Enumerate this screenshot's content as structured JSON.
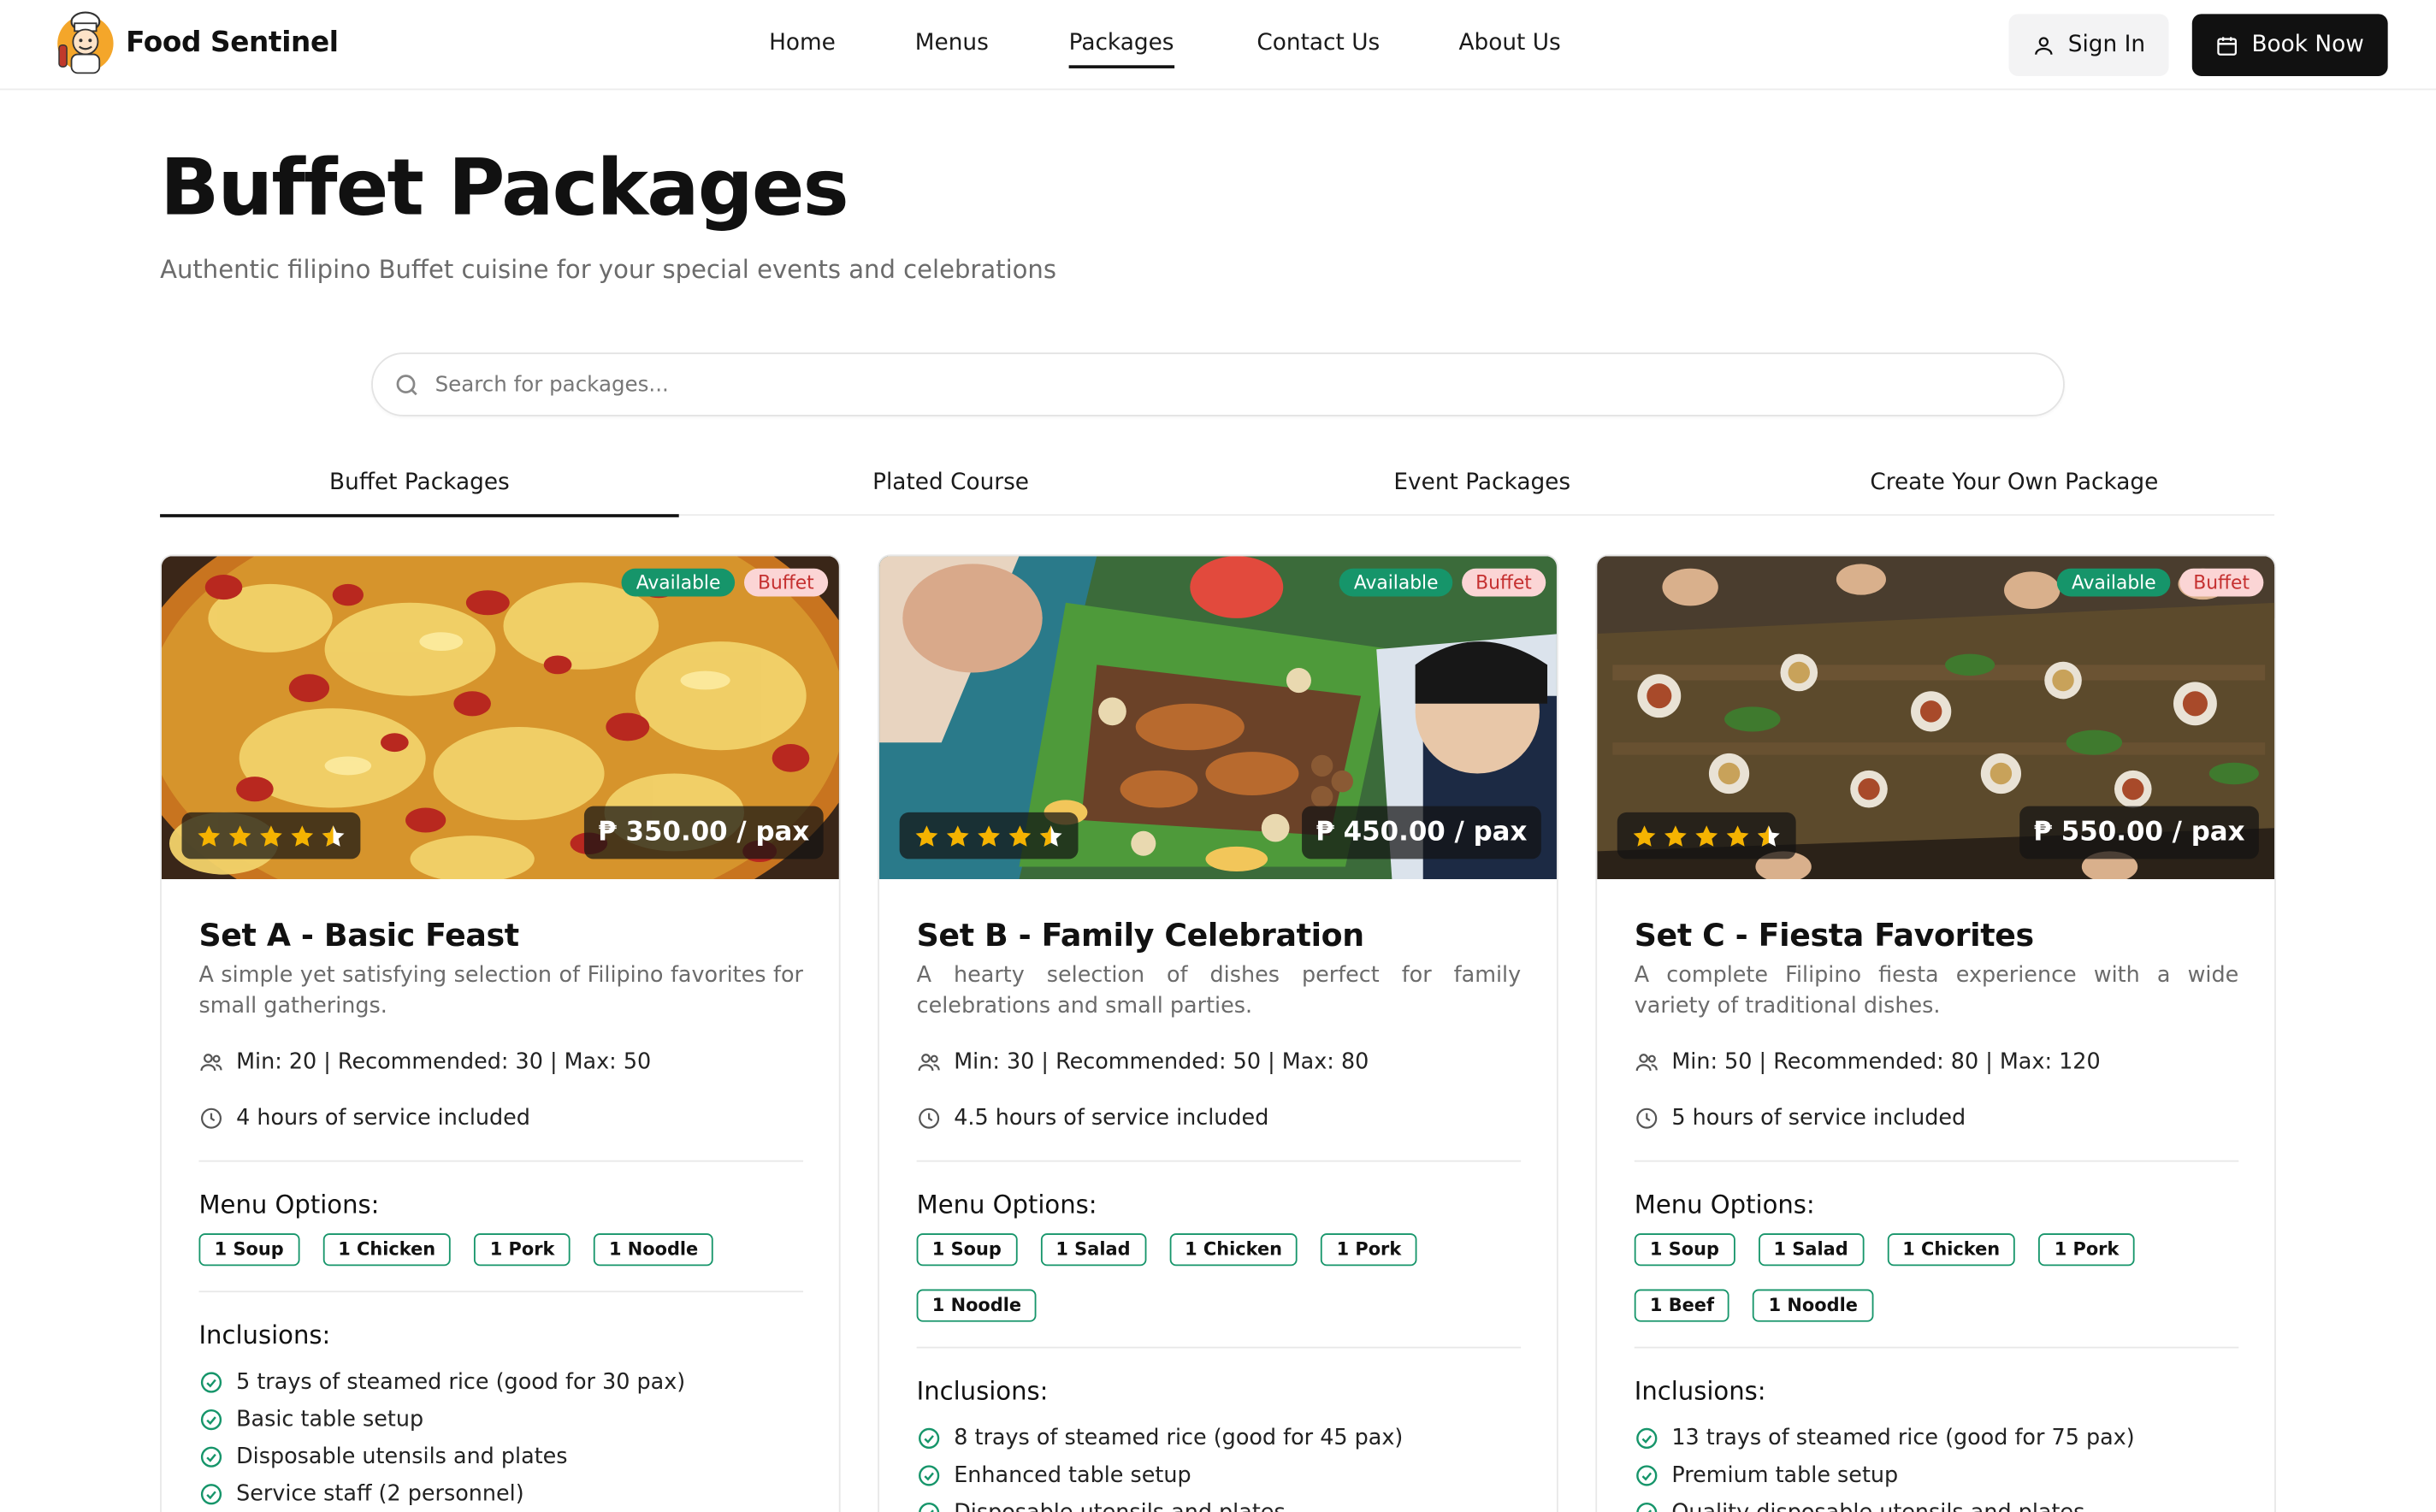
{
  "brand": {
    "name": "Food Sentinel"
  },
  "nav": {
    "links": [
      "Home",
      "Menus",
      "Packages",
      "Contact Us",
      "About Us"
    ],
    "active": "Packages",
    "sign_in": "Sign In",
    "book_now": "Book Now"
  },
  "header": {
    "title": "Buffet Packages",
    "subtitle": "Authentic filipino Buffet cuisine for your special events and celebrations"
  },
  "search": {
    "placeholder": "Search for packages..."
  },
  "tabs": {
    "items": [
      "Buffet Packages",
      "Plated Course",
      "Event Packages",
      "Create Your Own Package"
    ],
    "active": "Buffet Packages"
  },
  "colors": {
    "accent": "#16956a",
    "badge_buffet_bg": "#fbd5d5",
    "badge_buffet_text": "#c53030",
    "primary": "#111111",
    "star": "#f5b301"
  },
  "cards": [
    {
      "badge_status": "Available",
      "badge_type": "Buffet",
      "rating": 4.5,
      "price": "₱ 350.00 / pax",
      "name": "Set A - Basic Feast",
      "description": "A simple yet satisfying selection of Filipino favorites for small gatherings.",
      "capacity": "Min: 20 | Recommended: 30 | Max: 50",
      "service": "4 hours of service included",
      "menu_heading": "Menu Options:",
      "menu": [
        "1 Soup",
        "1 Chicken",
        "1 Pork",
        "1 Noodle"
      ],
      "inclusions_heading": "Inclusions:",
      "inclusions": [
        "5 trays of steamed rice (good for 30 pax)",
        "Basic table setup",
        "Disposable utensils and plates",
        "Service staff (2 personnel)"
      ]
    },
    {
      "badge_status": "Available",
      "badge_type": "Buffet",
      "rating": 4.5,
      "price": "₱ 450.00 / pax",
      "name": "Set B - Family Celebration",
      "description": "A hearty selection of dishes perfect for family celebrations and small parties.",
      "capacity": "Min: 30 | Recommended: 50 | Max: 80",
      "service": "4.5 hours of service included",
      "menu_heading": "Menu Options:",
      "menu": [
        "1 Soup",
        "1 Salad",
        "1 Chicken",
        "1 Pork",
        "1 Noodle"
      ],
      "inclusions_heading": "Inclusions:",
      "inclusions": [
        "8 trays of steamed rice (good for 45 pax)",
        "Enhanced table setup",
        "Disposable utensils and plates"
      ]
    },
    {
      "badge_status": "Available",
      "badge_type": "Buffet",
      "rating": 4.5,
      "price": "₱ 550.00 / pax",
      "name": "Set C - Fiesta Favorites",
      "description": "A complete Filipino fiesta experience with a wide variety of traditional dishes.",
      "capacity": "Min: 50 | Recommended: 80 | Max: 120",
      "service": "5 hours of service included",
      "menu_heading": "Menu Options:",
      "menu": [
        "1 Soup",
        "1 Salad",
        "1 Chicken",
        "1 Pork",
        "1 Beef",
        "1 Noodle"
      ],
      "inclusions_heading": "Inclusions:",
      "inclusions": [
        "13 trays of steamed rice (good for 75 pax)",
        "Premium table setup",
        "Quality disposable utensils and plates"
      ]
    }
  ]
}
